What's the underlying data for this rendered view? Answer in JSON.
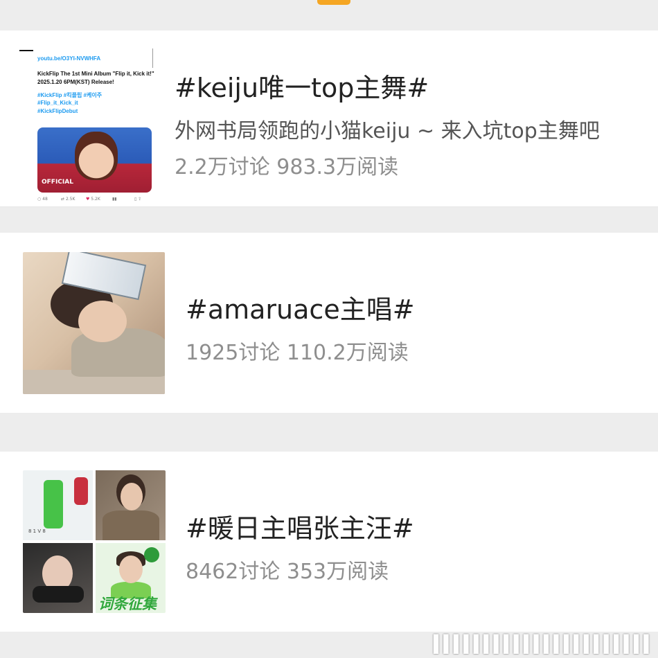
{
  "topics": [
    {
      "title": "#keiju唯一top主舞#",
      "description": "外网书局领跑的小猫keiju ~ 来入坑top主舞吧",
      "stats": "2.2万讨论 983.3万阅读",
      "thumbnail": {
        "link": "youtu.be/O3YI-NVWHFA",
        "line1": "KickFlip The 1st Mini Album \"Flip it, Kick it!\"",
        "line2": "2025.1.20 6PM(KST) Release!",
        "tags1": "#KickFlip #킥플립 #케이주",
        "tags2": "#Flip_it_Kick_it",
        "tags3": "#KickFlipDebut",
        "photo_caption": "OFFICIAL",
        "replies": "48",
        "retweets": "2.5K",
        "likes": "5.2K"
      }
    },
    {
      "title": "#amaruace主唱#",
      "stats": "1925讨论 110.2万阅读"
    },
    {
      "title": "#暖日主唱张主汪#",
      "stats": "8462讨论 353万阅读",
      "thumbnail": {
        "grid_caption": "词条征集"
      }
    }
  ],
  "colors": {
    "accent": "#f5a623",
    "title": "#222222",
    "stats": "#8e8e8e",
    "background": "#ededed"
  }
}
